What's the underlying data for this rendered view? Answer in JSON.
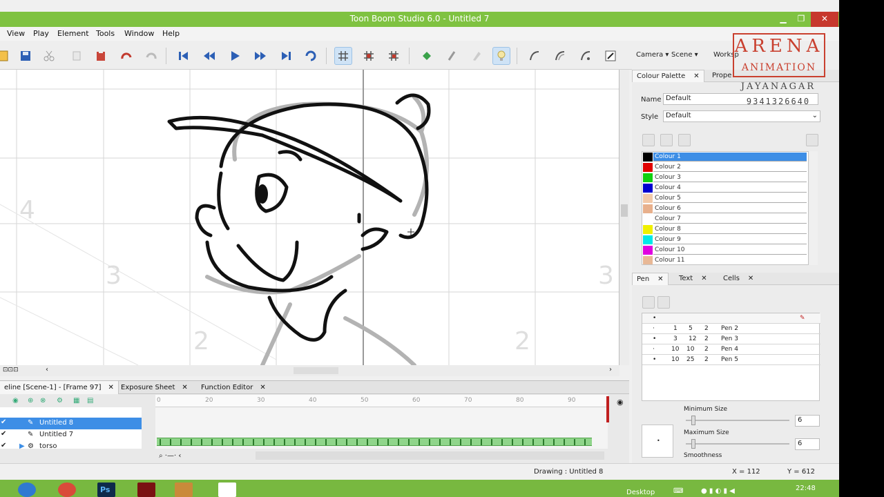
{
  "window": {
    "title": "Toon Boom Studio 6.0 - Untitled 7",
    "min_icon": "minimize-icon",
    "max_icon": "maximize-icon",
    "close_label": "✕"
  },
  "menu": [
    "View",
    "Play",
    "Element",
    "Tools",
    "Window",
    "Help"
  ],
  "top_right": {
    "camera": "Camera ▾",
    "scene": "Scene ▾",
    "workspace": "Worksp"
  },
  "logo": {
    "line1": "ARENA",
    "line2": "ANIMATION",
    "line3": "JAYANAGAR",
    "line4": "9341326640"
  },
  "colour_palette": {
    "tab_label": "Colour Palette",
    "tab2_label": "Prope",
    "name_label": "Name",
    "name_value": "Default",
    "style_label": "Style",
    "style_value": "Default",
    "colours": [
      {
        "name": "Colour 1",
        "color": "#000000"
      },
      {
        "name": "Colour 2",
        "color": "#e00000"
      },
      {
        "name": "Colour 3",
        "color": "#10d010"
      },
      {
        "name": "Colour 4",
        "color": "#0000d0"
      },
      {
        "name": "Colour 5",
        "color": "#f2c9a8"
      },
      {
        "name": "Colour 6",
        "color": "#e8b08c"
      },
      {
        "name": "Colour 7",
        "color": "#ffffff"
      },
      {
        "name": "Colour 8",
        "color": "#f0f000"
      },
      {
        "name": "Colour 9",
        "color": "#00e8e8"
      },
      {
        "name": "Colour 10",
        "color": "#e000e0"
      },
      {
        "name": "Colour 11",
        "color": "#e8b896"
      }
    ]
  },
  "pen_panel": {
    "tabs": [
      "Pen",
      "Text",
      "Cells"
    ],
    "rows": [
      {
        "a": "1",
        "b": "5",
        "c": "2",
        "name": "Pen 2"
      },
      {
        "a": "3",
        "b": "12",
        "c": "2",
        "name": "Pen 3"
      },
      {
        "a": "10",
        "b": "10",
        "c": "2",
        "name": "Pen 4"
      },
      {
        "a": "10",
        "b": "25",
        "c": "2",
        "name": "Pen 5"
      }
    ],
    "min_size_label": "Minimum Size",
    "min_size_value": "6",
    "max_size_label": "Maximum Size",
    "max_size_value": "6",
    "smoothness_label": "Smoothness"
  },
  "timeline": {
    "tabs": [
      "eline [Scene-1] - [Frame 97]",
      "Exposure Sheet",
      "Function Editor"
    ],
    "ruler": [
      "0",
      "20",
      "30",
      "40",
      "50",
      "60",
      "70",
      "80",
      "90"
    ],
    "layers": [
      "Untitled 8",
      "Untitled 7",
      "torso"
    ]
  },
  "status": {
    "drawing": "Drawing : Untitled 8",
    "x": "X = 112",
    "y": "Y = 612"
  },
  "taskbar": {
    "desktop": "Desktop",
    "clock": "22:48"
  },
  "canvas": {
    "field_numbers": [
      "4",
      "3",
      "3",
      "2",
      "2"
    ]
  }
}
